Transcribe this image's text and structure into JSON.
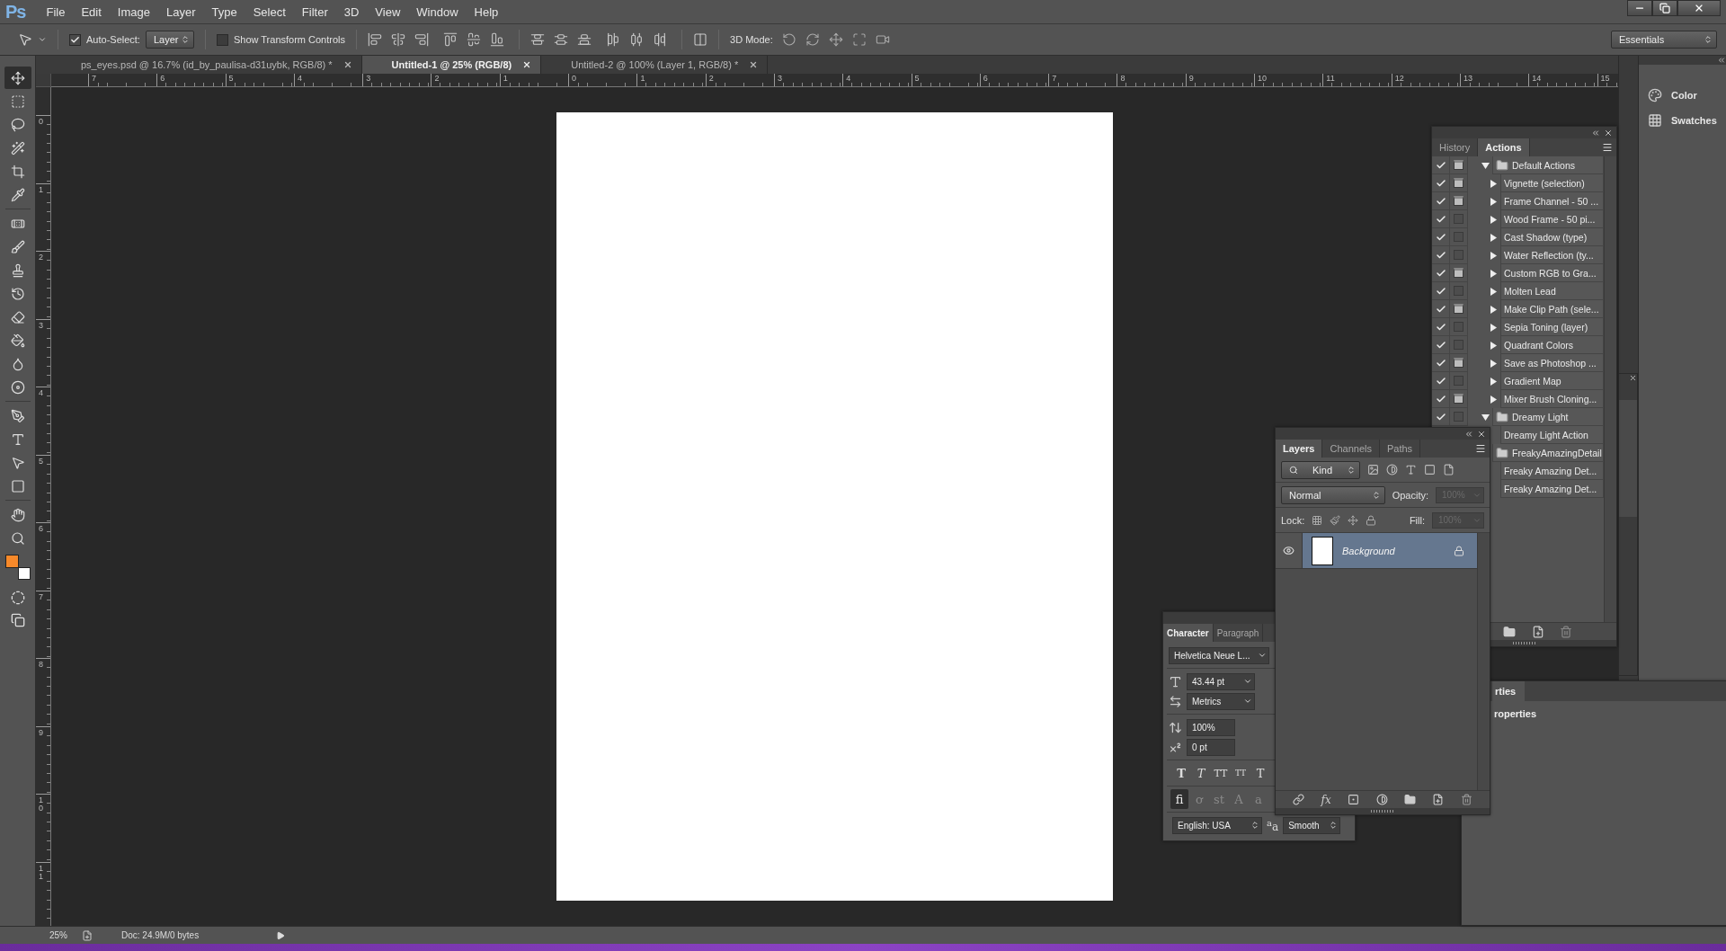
{
  "menu_bar": {
    "logo": "Ps",
    "items": [
      "File",
      "Edit",
      "Image",
      "Layer",
      "Type",
      "Select",
      "Filter",
      "3D",
      "View",
      "Window",
      "Help"
    ],
    "window_controls": [
      {
        "kind": "minimize"
      },
      {
        "kind": "restore"
      },
      {
        "kind": "close"
      }
    ]
  },
  "options_bar": {
    "auto_select": {
      "label": "Auto-Select:",
      "checked": true
    },
    "target": {
      "value": "Layer"
    },
    "transform_controls": {
      "label": "Show Transform Controls",
      "checked": false
    },
    "mode_label": "3D Mode:",
    "workspace": {
      "value": "Essentials"
    }
  },
  "document_tabs": [
    {
      "title": "ps_eyes.psd @ 16.7% (id_by_paulisa-d31uybk, RGB/8) *",
      "selected": false
    },
    {
      "title": "Untitled-1 @ 25% (RGB/8)",
      "selected": true
    },
    {
      "title": "Untitled-2 @ 100% (Layer 1, RGB/8) *",
      "selected": false
    }
  ],
  "rulers": {
    "horizontal": [
      "7",
      "6",
      "5",
      "4",
      "3",
      "2",
      "1",
      "0",
      "1",
      "2",
      "3",
      "4",
      "5",
      "6",
      "7",
      "8",
      "9",
      "10",
      "11",
      "12",
      "13",
      "14",
      "15"
    ],
    "vertical": [
      "0",
      "1",
      "2",
      "3",
      "4",
      "5",
      "6",
      "7",
      "8",
      "9",
      "10",
      "11"
    ]
  },
  "tools": [
    {
      "kind": "move",
      "selected": true
    },
    {
      "kind": "marquee",
      "selected": false
    },
    {
      "kind": "lasso",
      "selected": false
    },
    {
      "kind": "wand",
      "selected": false
    },
    {
      "kind": "crop",
      "selected": false
    },
    {
      "kind": "eyedropper",
      "selected": false
    },
    {
      "kind": "healing",
      "selected": false
    },
    {
      "kind": "brush",
      "selected": false
    },
    {
      "kind": "stamp",
      "selected": false
    },
    {
      "kind": "history",
      "selected": false
    },
    {
      "kind": "eraser",
      "selected": false
    },
    {
      "kind": "bucket",
      "selected": false
    },
    {
      "kind": "blur",
      "selected": false
    },
    {
      "kind": "dodge",
      "selected": false
    },
    {
      "kind": "pen",
      "selected": false
    },
    {
      "kind": "type",
      "selected": false
    },
    {
      "kind": "path",
      "selected": false
    },
    {
      "kind": "shape",
      "selected": false
    },
    {
      "kind": "hand",
      "selected": false
    },
    {
      "kind": "zoom",
      "selected": false
    }
  ],
  "color_swatches": [
    {
      "kind": "foreground",
      "color": "#f7892a"
    },
    {
      "kind": "background",
      "color": "#ffffff"
    }
  ],
  "actions_panel": {
    "tabs": [
      {
        "label": "History",
        "selected": false
      },
      {
        "label": "Actions",
        "selected": true
      }
    ],
    "items": [
      {
        "kind": "set",
        "name": "Default Actions",
        "checked": true,
        "dialog": true,
        "expanded": true,
        "children": [
          {
            "kind": "action",
            "name": "Vignette (selection)",
            "checked": true,
            "dialog": true,
            "expanded": false
          },
          {
            "kind": "action",
            "name": "Frame Channel - 50 ...",
            "checked": true,
            "dialog": true,
            "expanded": false
          },
          {
            "kind": "action",
            "name": "Wood Frame - 50 pi...",
            "checked": true,
            "dialog": false,
            "expanded": false
          },
          {
            "kind": "action",
            "name": "Cast Shadow (type)",
            "checked": true,
            "dialog": false,
            "expanded": false
          },
          {
            "kind": "action",
            "name": "Water Reflection (ty...",
            "checked": true,
            "dialog": false,
            "expanded": false
          },
          {
            "kind": "action",
            "name": "Custom RGB to Gra...",
            "checked": true,
            "dialog": true,
            "expanded": false
          },
          {
            "kind": "action",
            "name": "Molten Lead",
            "checked": true,
            "dialog": false,
            "expanded": false
          },
          {
            "kind": "action",
            "name": "Make Clip Path (sele...",
            "checked": true,
            "dialog": true,
            "expanded": false
          },
          {
            "kind": "action",
            "name": "Sepia Toning (layer)",
            "checked": true,
            "dialog": false,
            "expanded": false
          },
          {
            "kind": "action",
            "name": "Quadrant Colors",
            "checked": true,
            "dialog": false,
            "expanded": false
          },
          {
            "kind": "action",
            "name": "Save as Photoshop ...",
            "checked": true,
            "dialog": true,
            "expanded": false
          },
          {
            "kind": "action",
            "name": "Gradient Map",
            "checked": true,
            "dialog": false,
            "expanded": false
          },
          {
            "kind": "action",
            "name": "Mixer Brush Cloning...",
            "checked": true,
            "dialog": true,
            "expanded": false
          }
        ]
      },
      {
        "kind": "set",
        "name": "Dreamy Light",
        "checked": true,
        "dialog": false,
        "expanded": true,
        "children": [
          {
            "kind": "action",
            "name": "Dreamy Light Action"
          }
        ]
      },
      {
        "kind": "set",
        "name": "FreakyAmazingDetail",
        "children": [
          {
            "kind": "action",
            "name": "Freaky Amazing Det..."
          },
          {
            "kind": "action",
            "name": "Freaky Amazing Det..."
          }
        ]
      }
    ]
  },
  "layers_panel": {
    "tabs": [
      {
        "label": "Layers",
        "selected": true
      },
      {
        "label": "Channels",
        "selected": false
      },
      {
        "label": "Paths",
        "selected": false
      }
    ],
    "filter": {
      "value": "Kind"
    },
    "blend_mode": {
      "value": "Normal"
    },
    "opacity": {
      "label": "Opacity:",
      "value": "100%",
      "disabled": true
    },
    "lock_label": "Lock:",
    "fill": {
      "label": "Fill:",
      "value": "100%",
      "disabled": true
    },
    "layers": [
      {
        "name": "Background",
        "visible": true,
        "locked": true,
        "selected": true
      }
    ],
    "fx_label": "fx"
  },
  "character_panel": {
    "tabs": [
      {
        "label": "Character",
        "selected": true
      },
      {
        "label": "Paragraph",
        "selected": false
      }
    ],
    "font_family": "Helvetica Neue L...",
    "font_size": "43.44 pt",
    "kerning": "Metrics",
    "vertical_scale": "100%",
    "baseline_shift": "0 pt",
    "style_buttons": [
      {
        "kind": "bold",
        "label": "T"
      },
      {
        "kind": "italic",
        "label": "T"
      },
      {
        "kind": "caps",
        "label": "TT"
      },
      {
        "kind": "small_caps",
        "label": "TT"
      },
      {
        "kind": "plain",
        "label": "T"
      }
    ],
    "ligature_buttons": [
      {
        "label": "fi",
        "selected": true
      },
      {
        "label": "ơ",
        "selected": false
      },
      {
        "label": "st",
        "selected": false
      },
      {
        "label": "A",
        "selected": false
      },
      {
        "label": "a",
        "selected": false
      }
    ],
    "language": "English: USA",
    "antialias_label": "$^{a}$a",
    "antialias": "Smooth"
  },
  "right_dock": {
    "items": [
      {
        "kind": "color",
        "label": "Color"
      },
      {
        "kind": "swatches",
        "label": "Swatches"
      }
    ]
  },
  "properties_panel": {
    "tab": "rties",
    "title": "roperties"
  },
  "status_bar": {
    "zoom": "25%",
    "doc_info": "Doc: 24.9M/0 bytes"
  }
}
